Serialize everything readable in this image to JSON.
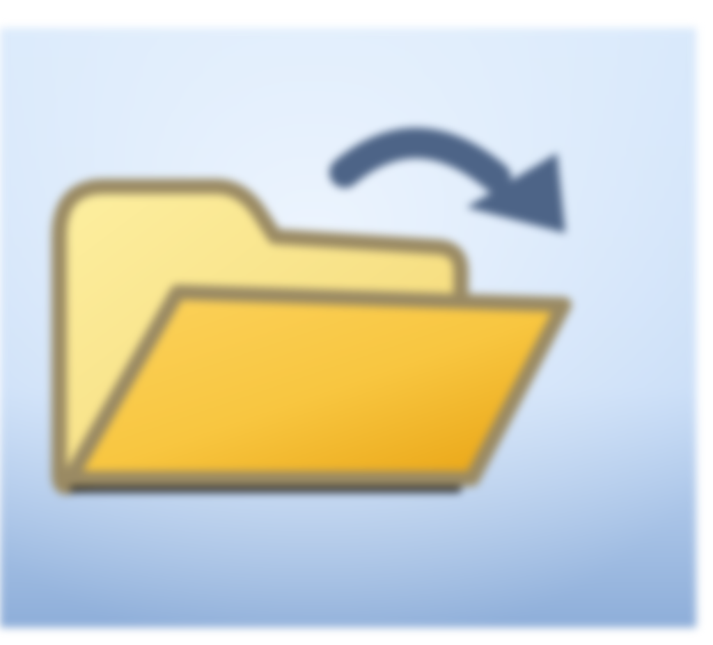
{
  "toolbar_button": {
    "icon": "open-folder-with-arrow-icon",
    "state": "hovered",
    "colors": {
      "button_bg_top": "#d7e8fb",
      "button_bg_mid": "#c7dcf7",
      "button_bg_bottom": "#8eaed9",
      "button_highlight": "#f2f8ff",
      "folder_back": "#fdefa0",
      "folder_front_top": "#fcd35e",
      "folder_front_bottom": "#e9a414",
      "folder_outline": "#9a8a63",
      "folder_shadow": "#1a1a1a",
      "arrow": "#4d6487"
    }
  }
}
